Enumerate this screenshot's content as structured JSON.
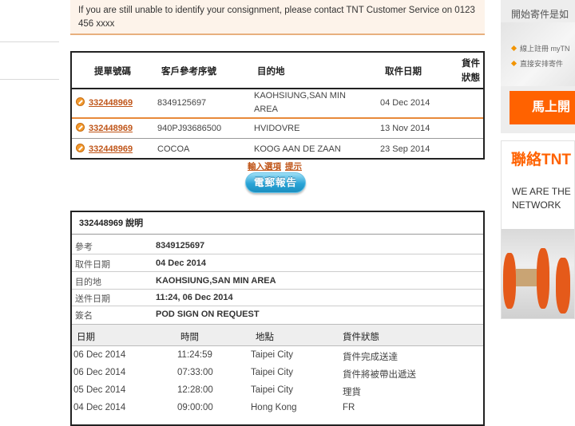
{
  "notice": {
    "text": "If you are still unable to identify your consignment, please contact TNT Customer Service on 0123 456 xxxx"
  },
  "results": {
    "headers": {
      "waybill": "提單號碼",
      "customer_ref": "客戶參考序號",
      "destination": "目的地",
      "collection_date": "取件日期",
      "status_line1": "貨件",
      "status_line2": "狀態"
    },
    "rows": [
      {
        "waybill": "332448969",
        "ref": "8349125697",
        "dest_line1": "KAOHSIUNG,SAN MIN",
        "dest_line2": "AREA",
        "date": "04 Dec 2014"
      },
      {
        "waybill": "332448969",
        "ref": "940PJ93686500",
        "dest_line1": "HVIDOVRE",
        "dest_line2": "",
        "date": "13 Nov 2014"
      },
      {
        "waybill": "332448969",
        "ref": "COCOA",
        "dest_line1": "KOOG AAN DE ZAAN",
        "dest_line2": "",
        "date": "23 Sep 2014"
      }
    ]
  },
  "links": {
    "options": "輸入選項",
    "hint": "提示"
  },
  "email_button": "電郵報告",
  "details": {
    "title": "332448969 說明",
    "fields": [
      {
        "label": "參考",
        "value": "8349125697"
      },
      {
        "label": "取件日期",
        "value": "04 Dec 2014"
      },
      {
        "label": "目的地",
        "value": "KAOHSIUNG,SAN MIN AREA"
      },
      {
        "label": "送件日期",
        "value": "11:24, 06 Dec 2014"
      },
      {
        "label": "簽名",
        "value": "POD SIGN ON REQUEST"
      }
    ],
    "event_headers": {
      "date": "日期",
      "time": "時間",
      "location": "地點",
      "status": "貨件狀態"
    },
    "events": [
      {
        "date": "06 Dec 2014",
        "time": "11:24:59",
        "location": "Taipei City",
        "status": "貨件完成送達"
      },
      {
        "date": "06 Dec 2014",
        "time": "07:33:00",
        "location": "Taipei City",
        "status": "貨件將被帶出遞送"
      },
      {
        "date": "05 Dec 2014",
        "time": "12:28:00",
        "location": "Taipei City",
        "status": "理貨"
      },
      {
        "date": "04 Dec 2014",
        "time": "09:00:00",
        "location": "Hong Kong",
        "status": "FR"
      }
    ]
  },
  "sidebar": {
    "ship_title": "開始寄件是如",
    "bullet1": "線上註冊 myTN",
    "bullet2": "直接安排寄件",
    "ship_button": "馬上開",
    "contact_title": "聯絡TNT",
    "slogan_line1": "WE ARE THE",
    "slogan_line2": "NETWORK"
  },
  "colors": {
    "accent": "#ff6200",
    "link": "#c0561a",
    "button_blue": "#2aa4d7"
  }
}
